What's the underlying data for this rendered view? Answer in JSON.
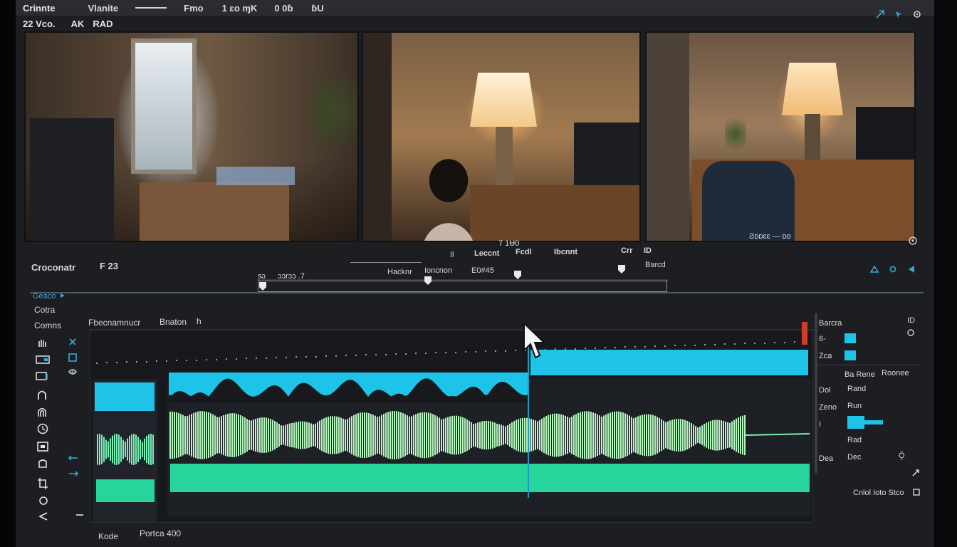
{
  "menubar": {
    "app_title": "Crinnte",
    "items": [
      "Vlanite",
      "Fmo",
      "1 ɛo ɱK",
      "0 0ɓ",
      "ɓU"
    ]
  },
  "subbar": {
    "left_label": "22 Vco.",
    "mid_label": "AK",
    "mid_label2": "RAD"
  },
  "viewers": {
    "caption_right": "Ƨᴅᴅɛɛ —  ᴅᴅ"
  },
  "mid": {
    "left_title": "Croconatr",
    "left_value": "F 23",
    "center_top": "7 1Ʉ0",
    "labels_row": [
      "Il",
      "Leccnt",
      "Fcdl",
      "Ibcnnt",
      "Crr",
      "ID"
    ],
    "scrub_left": "s̵ɔ",
    "scrub_left2": "ɔɔrɔɔ .7",
    "scrub_mid": "Hacknr",
    "scrub_mid2": "Ioncnon",
    "scrub_mid3": "E0#45",
    "scrub_right": "Barcd"
  },
  "left_panel": {
    "top1": "Geaco",
    "top2": "Cotra",
    "label": "Comns"
  },
  "timeline": {
    "title": "Fbecnamnucr",
    "title2": "Bnaton",
    "title3": "h"
  },
  "inspector": {
    "header": "Barcra",
    "header_right": "ID",
    "rows": [
      "6-",
      "Zca",
      "Ba  Rene",
      "Roonee",
      "Dol",
      "Rand",
      "Zeno",
      "Run",
      "I",
      "Rad",
      "Dea",
      "Dec",
      "Ǭ"
    ],
    "accent": "#1ec3e8"
  },
  "footer": {
    "left": "Kode",
    "mid": "Portca 400",
    "right": "Cnlol  Ioto  Stco"
  }
}
